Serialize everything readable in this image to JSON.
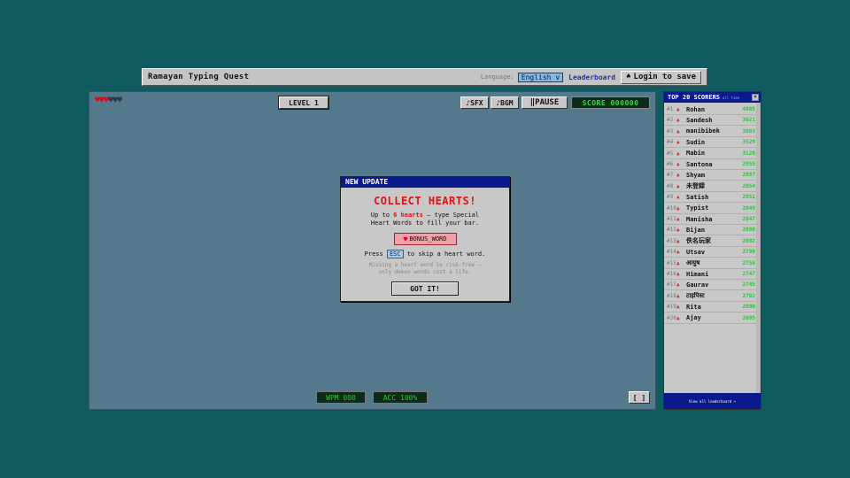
{
  "app": {
    "title": "Ramayan Typing Quest",
    "language_label": "Language:",
    "language_value": "English",
    "leaderboard_link": "Leaderboard",
    "login_label": "Login to save"
  },
  "hud": {
    "hearts_total": 6,
    "hearts_full": 3,
    "level_label": "LEVEL 1",
    "sfx_label": "♪SFX",
    "bgm_label": "♪BGM",
    "pause_label": "‖PAUSE",
    "score_label": "SCORE 000000",
    "wpm_label": "WPM 000",
    "acc_label": "ACC 100%",
    "fullscreen_label": "[ ]"
  },
  "modal": {
    "header": "NEW UPDATE",
    "title": "COLLECT HEARTS!",
    "line1_prefix": "Up to",
    "line1_highlight": "6 hearts",
    "line1_suffix": "— type Special",
    "line2": "Heart Words to fill your bar.",
    "bonus_word": "BONUS_WORD",
    "esc_prefix": "Press",
    "esc_key": "ESC",
    "esc_suffix": "to skip a heart word.",
    "note_line1": "Missing a heart word is risk-free —",
    "note_line2": "only demon words cost a life.",
    "button": "GOT IT!"
  },
  "leaderboard": {
    "title": "TOP 20 SCORERS",
    "subtitle": "all time",
    "footer": "View all leaderboard →",
    "rows": [
      {
        "rank": "#1",
        "name": "Rohan",
        "score": "4085"
      },
      {
        "rank": "#2",
        "name": "Sandesh",
        "score": "3621"
      },
      {
        "rank": "#3",
        "name": "manibibek",
        "score": "3603"
      },
      {
        "rank": "#4",
        "name": "Sudin",
        "score": "3529"
      },
      {
        "rank": "#5",
        "name": "Mabin",
        "score": "3128"
      },
      {
        "rank": "#6",
        "name": "Santona",
        "score": "2955"
      },
      {
        "rank": "#7",
        "name": "Shyam",
        "score": "2887"
      },
      {
        "rank": "#8",
        "name": "未登録",
        "score": "2854"
      },
      {
        "rank": "#9",
        "name": "Satish",
        "score": "2851"
      },
      {
        "rank": "#10",
        "name": "Typist",
        "score": "2849"
      },
      {
        "rank": "#11",
        "name": "Manisha",
        "score": "2847"
      },
      {
        "rank": "#12",
        "name": "Bijan",
        "score": "2808"
      },
      {
        "rank": "#13",
        "name": "佚名玩家",
        "score": "2802"
      },
      {
        "rank": "#14",
        "name": "Utsav",
        "score": "2790"
      },
      {
        "rank": "#15",
        "name": "आयुष",
        "score": "2756"
      },
      {
        "rank": "#16",
        "name": "Himani",
        "score": "2747"
      },
      {
        "rank": "#17",
        "name": "Gaurav",
        "score": "2745"
      },
      {
        "rank": "#18",
        "name": "टाइपिस्ट",
        "score": "2702"
      },
      {
        "rank": "#19",
        "name": "Rita",
        "score": "2690"
      },
      {
        "rank": "#20",
        "name": "Ajay",
        "score": "2685"
      }
    ]
  }
}
